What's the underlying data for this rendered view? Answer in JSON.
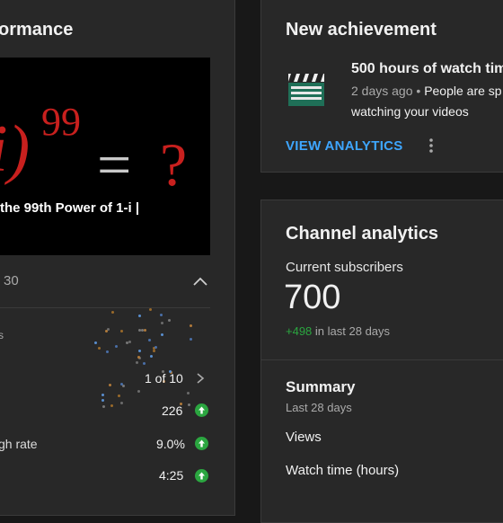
{
  "performance": {
    "title_fragment": "ormance",
    "thumbnail": {
      "formula_paren": "i)",
      "formula_exp": "99",
      "formula_rest": "= ?",
      "caption": "the 99th Power of 1-i |"
    },
    "range_fragment": "30",
    "legend_fragment": "s",
    "pager": "1 of 10",
    "metrics": [
      {
        "label": "",
        "value": "226",
        "trend": "up"
      },
      {
        "label": "gh rate",
        "value": "9.0%",
        "trend": "up"
      },
      {
        "label": "",
        "value": "4:25",
        "trend": "up"
      }
    ]
  },
  "achievement": {
    "title": "New achievement",
    "headline": "500 hours of watch tim",
    "time_ago": "2 days ago",
    "separator": "•",
    "body_line1": "People are sp",
    "body_line2": "watching your videos",
    "action_label": "VIEW ANALYTICS"
  },
  "analytics": {
    "title": "Channel analytics",
    "subscribers_label": "Current subscribers",
    "subscribers_value": "700",
    "delta_value": "+498",
    "delta_suffix": "in last 28 days",
    "summary_title": "Summary",
    "summary_period": "Last 28 days",
    "rows": [
      "Views",
      "Watch time (hours)"
    ]
  },
  "colors": {
    "background": "#181818",
    "card": "#282828",
    "accent_link": "#3ea6ff",
    "positive": "#2ba640",
    "formula_red": "#c8201e"
  }
}
